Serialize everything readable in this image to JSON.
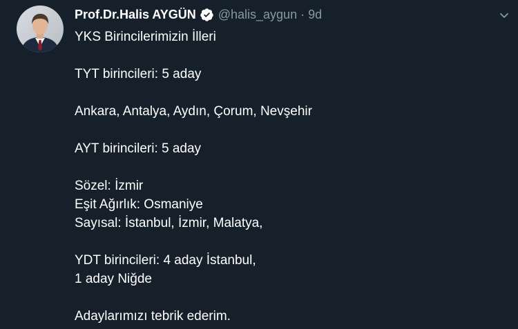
{
  "tweet": {
    "display_name": "Prof.Dr.Halis AYGÜN",
    "handle": "@halis_aygun",
    "separator": "·",
    "time": "9d",
    "lines": [
      "YKS Birincilerimizin İlleri",
      "",
      "TYT birincileri: 5 aday",
      "",
      "Ankara, Antalya, Aydın, Çorum, Nevşehir",
      "",
      "AYT birincileri: 5 aday",
      "",
      "Sözel: İzmir",
      "Eşit Ağırlık: Osmaniye",
      "Sayısal: İstanbul, İzmir, Malatya,",
      "",
      "YDT birincileri: 4 aday İstanbul,",
      "1 aday Niğde",
      "",
      "Adaylarımızı tebrik ederim."
    ]
  },
  "icons": {
    "verified": "verified-badge-icon",
    "more": "chevron-down-icon"
  },
  "colors": {
    "background": "#15202b",
    "text": "#ffffff",
    "muted": "#8899a6"
  }
}
